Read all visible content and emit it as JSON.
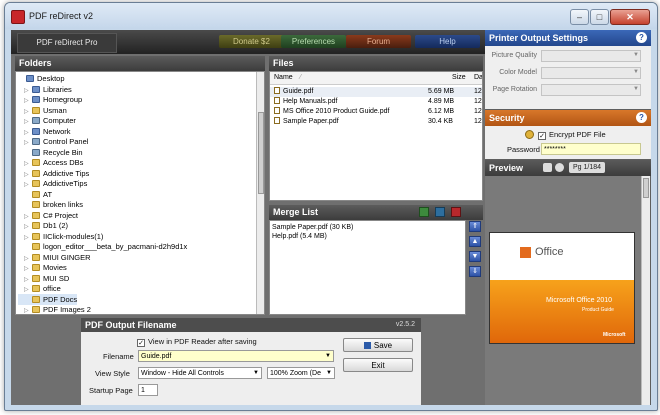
{
  "window": {
    "title": "PDF reDirect v2",
    "controls": {
      "minimize": "–",
      "maximize": "□",
      "close": "✕"
    }
  },
  "toolbar": {
    "brand": "PDF reDirect Pro",
    "donate": "Donate $2",
    "preferences": "Preferences",
    "forum": "Forum",
    "help": "Help"
  },
  "folders": {
    "header": "Folders",
    "items": [
      {
        "label": "Desktop",
        "icon": "desktop-icon",
        "expander": ""
      },
      {
        "label": "Libraries",
        "icon": "libraries-icon",
        "expander": "▷"
      },
      {
        "label": "Homegroup",
        "icon": "homegroup-icon",
        "expander": "▷"
      },
      {
        "label": "Usman",
        "icon": "user-folder-icon",
        "expander": "▷"
      },
      {
        "label": "Computer",
        "icon": "computer-icon",
        "expander": "▷"
      },
      {
        "label": "Network",
        "icon": "network-icon",
        "expander": "▷"
      },
      {
        "label": "Control Panel",
        "icon": "control-panel-icon",
        "expander": "▷"
      },
      {
        "label": "Recycle Bin",
        "icon": "recycle-bin-icon",
        "expander": ""
      },
      {
        "label": "Access DBs",
        "icon": "folder-icon",
        "expander": "▷"
      },
      {
        "label": "Addictive Tips",
        "icon": "folder-icon",
        "expander": "▷"
      },
      {
        "label": "AddictiveTips",
        "icon": "folder-icon",
        "expander": "▷"
      },
      {
        "label": "AT",
        "icon": "folder-icon",
        "expander": ""
      },
      {
        "label": "broken links",
        "icon": "folder-icon",
        "expander": ""
      },
      {
        "label": "C# Project",
        "icon": "folder-icon",
        "expander": "▷"
      },
      {
        "label": "Db1 (2)",
        "icon": "folder-icon",
        "expander": "▷"
      },
      {
        "label": "IIClick-modules(1)",
        "icon": "folder-icon",
        "expander": "▷"
      },
      {
        "label": "logon_editor___beta_by_pacmani-d2h9d1x",
        "icon": "folder-icon",
        "expander": ""
      },
      {
        "label": "MIUI GINGER",
        "icon": "folder-icon",
        "expander": "▷"
      },
      {
        "label": "Movies",
        "icon": "folder-icon",
        "expander": "▷"
      },
      {
        "label": "MUI SD",
        "icon": "folder-icon",
        "expander": "▷"
      },
      {
        "label": "office",
        "icon": "folder-icon",
        "expander": "▷"
      },
      {
        "label": "PDF Docs",
        "icon": "folder-icon",
        "expander": "",
        "selected": true
      },
      {
        "label": "PDF Images 2",
        "icon": "folder-icon",
        "expander": "▷"
      }
    ]
  },
  "files": {
    "header": "Files",
    "columns": [
      "Name",
      "Size",
      "Da"
    ],
    "rows": [
      {
        "name": "Guide.pdf",
        "size": "5.69 MB",
        "date": "12"
      },
      {
        "name": "Help Manuals.pdf",
        "size": "4.89 MB",
        "date": "12"
      },
      {
        "name": "MS Office 2010 Product Guide.pdf",
        "size": "6.12 MB",
        "date": "12"
      },
      {
        "name": "Sample Paper.pdf",
        "size": "30.4 KB",
        "date": "12"
      }
    ]
  },
  "merge": {
    "header": "Merge List",
    "items": [
      "Sample Paper.pdf (30 KB)",
      "Help.pdf (5.4 MB)"
    ]
  },
  "output": {
    "header": "PDF Output Filename",
    "version": "v2.5.2",
    "view_in_reader_label": "View in PDF Reader after saving",
    "filename_label": "Filename",
    "filename_value": "Guide.pdf",
    "view_style_label": "View Style",
    "view_style_value": "Window - Hide All Controls",
    "zoom_value": "100% Zoom (De",
    "startup_page_label": "Startup Page",
    "startup_page_value": "1",
    "save_label": "Save",
    "exit_label": "Exit"
  },
  "printer": {
    "header": "Printer Output Settings",
    "picture_quality_label": "Picture Quality",
    "color_model_label": "Color Model",
    "page_rotation_label": "Page Rotation"
  },
  "security": {
    "header": "Security",
    "encrypt_label": "Encrypt PDF File",
    "password_label": "Password",
    "password_value": "********"
  },
  "preview": {
    "header": "Preview",
    "page_indicator": "Pg 1/184",
    "doc_brand": "Office",
    "doc_title": "Microsoft Office 2010",
    "doc_subtitle": "Product Guide",
    "doc_footer": "Microsoft"
  },
  "colors": {
    "accent_blue": "#2b5aa8",
    "security_orange": "#c8691e",
    "field_yellow": "#ffffcc"
  }
}
